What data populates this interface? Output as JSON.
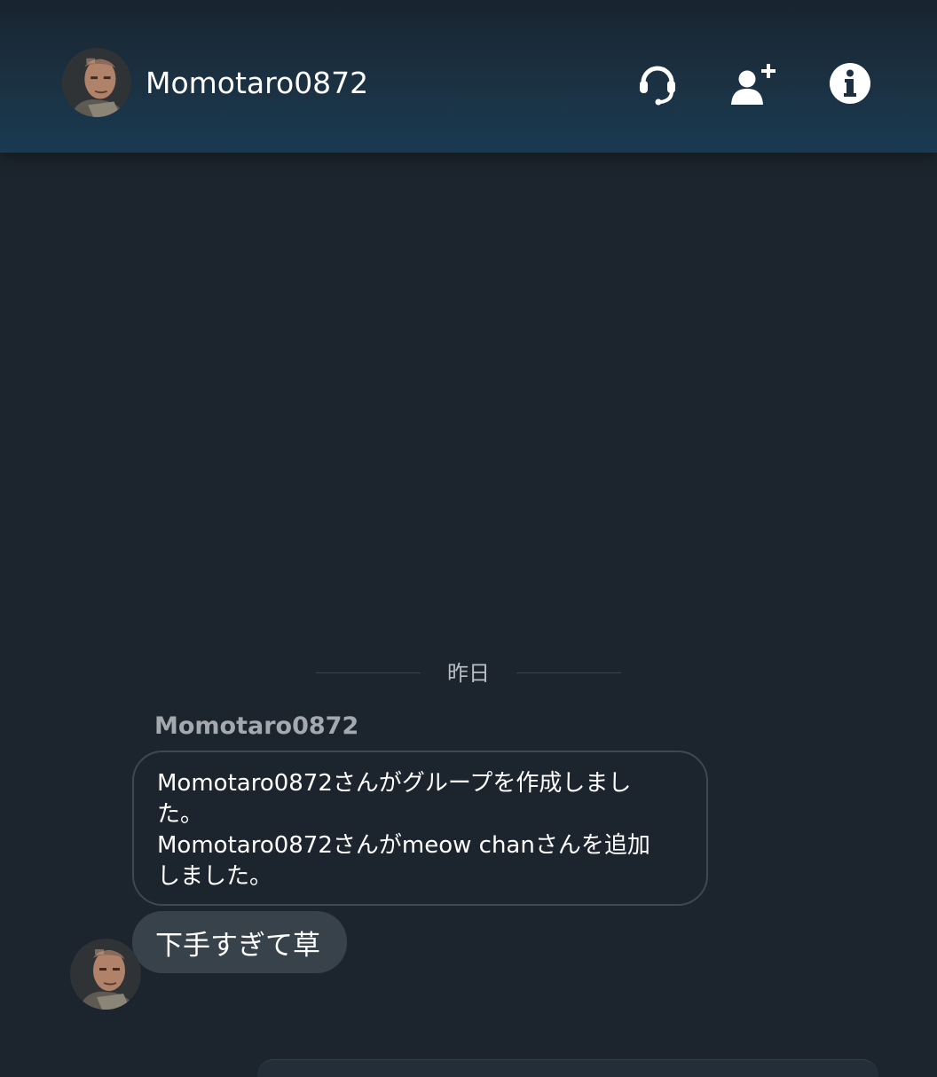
{
  "header": {
    "title": "Momotaro0872",
    "icons": [
      "headset-icon",
      "add-user-icon",
      "info-icon"
    ]
  },
  "date_separator": "昨日",
  "system_message": {
    "sender": "Momotaro0872",
    "lines": [
      "Momotaro0872さんがグループを作成しまし",
      "た。",
      "Momotaro0872さんがmeow chanさんを追加",
      "しました。"
    ]
  },
  "message": {
    "text": "下手すぎて草"
  },
  "colors": {
    "background": "#1c252e",
    "header": "#1a3a52",
    "bubble": "#37424b",
    "bubble_border": "#3e4850",
    "muted_text": "#a3a9af"
  }
}
